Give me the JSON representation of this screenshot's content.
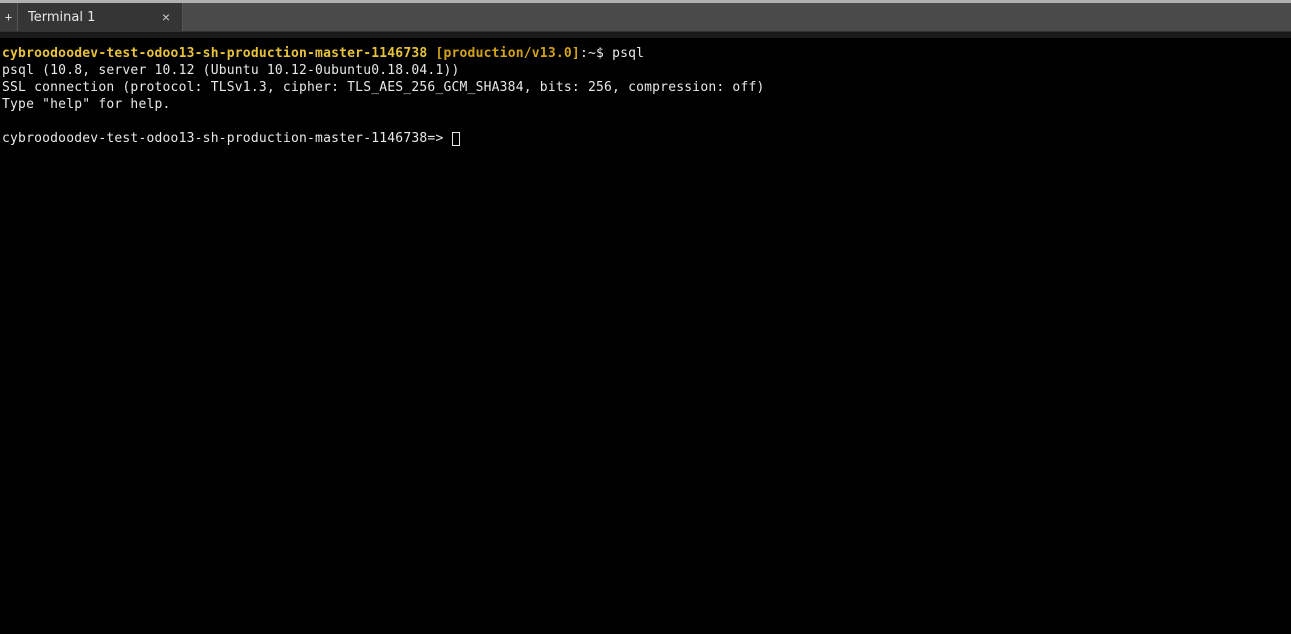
{
  "tabbar": {
    "add_symbol": "+",
    "tabs": [
      {
        "title": "Terminal 1",
        "close": "×"
      }
    ]
  },
  "terminal": {
    "prompt_host": "cybroodoodev-test-odoo13-sh-production-master-1146738",
    "prompt_branch": " [production/v13.0]",
    "prompt_sep": ":",
    "prompt_tilde": "~",
    "prompt_dollar": "$ ",
    "command": "psql",
    "output_line1": "psql (10.8, server 10.12 (Ubuntu 10.12-0ubuntu0.18.04.1))",
    "output_line2": "SSL connection (protocol: TLSv1.3, cipher: TLS_AES_256_GCM_SHA384, bits: 256, compression: off)",
    "output_line3": "Type \"help\" for help.",
    "psql_prompt": "cybroodoodev-test-odoo13-sh-production-master-1146738=> "
  }
}
